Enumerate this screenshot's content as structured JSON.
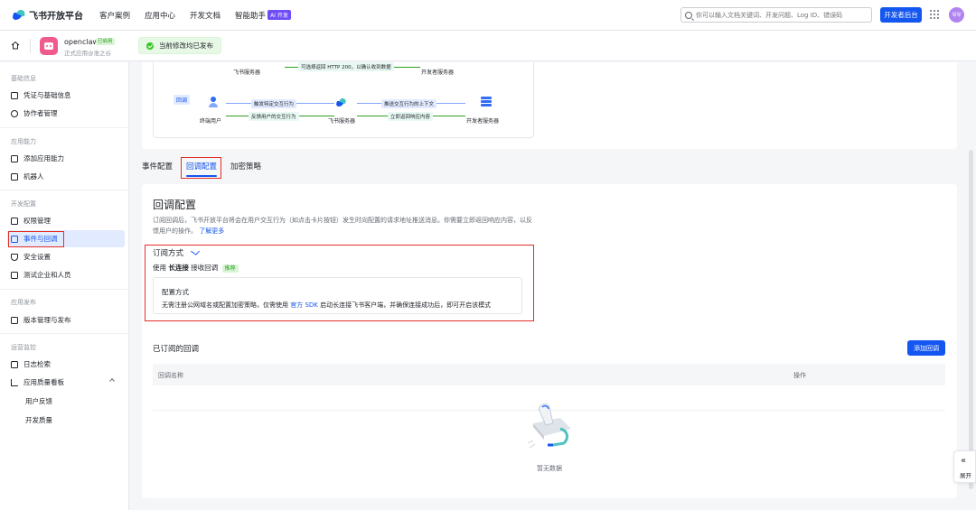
{
  "topbar": {
    "brand": "飞书开放平台",
    "nav": [
      "客户案例",
      "应用中心",
      "开发文档",
      "智能助手"
    ],
    "ai_badge": "AI 开发",
    "search_placeholder": "你可以输入文档关键词、开发问题、Log ID、错误码",
    "dev_button": "开发者后台",
    "avatar_text": "琴琴"
  },
  "appbar": {
    "app_name": "openclaw",
    "status_badge": "已启用",
    "app_subtitle": "正式应用@准之谷",
    "publish_notice": "当前修改均已发布"
  },
  "sidebar": {
    "groups": [
      {
        "title": "基础信息",
        "items": [
          "凭证与基础信息",
          "协作者管理"
        ]
      },
      {
        "title": "应用能力",
        "items": [
          "添加应用能力",
          "机器人"
        ]
      },
      {
        "title": "开发配置",
        "items": [
          "权限管理",
          "事件与回调",
          "安全设置",
          "测试企业和人员"
        ]
      },
      {
        "title": "应用发布",
        "items": [
          "版本管理与发布"
        ]
      },
      {
        "title": "运营监控",
        "items": [
          "日志检索",
          "应用质量看板"
        ]
      }
    ],
    "sub_items": [
      "用户反馈",
      "开发质量"
    ],
    "active_item": "事件与回调"
  },
  "diagram": {
    "top_pill": "可选择返回 HTTP 200，以确认收到数据",
    "top_left_label": "飞书服务器",
    "top_right_label": "开发者服务器",
    "callback_tag": "回调",
    "end_user": "终端用户",
    "feishu_server": "飞书服务器",
    "dev_server": "开发者服务器",
    "pill_trigger": "触发特定交互行为",
    "pill_feedback": "反馈用户的交互行为",
    "pill_push": "推送交互行为的上下文",
    "pill_return": "立即返回响应内容"
  },
  "tabs": [
    "事件配置",
    "回调配置",
    "加密策略"
  ],
  "active_tab": "回调配置",
  "callback": {
    "title": "回调配置",
    "desc": "订阅回调后，飞书开放平台将会在用户交互行为（如点击卡片按钮）发生时向配置的请求地址推送消息。你需要立即返回响应内容，以反馈用户的操作。",
    "learn_more": "了解更多",
    "sub_mode_label": "订阅方式",
    "use_prefix": "使用",
    "use_mode": "长连接",
    "use_suffix": "接收回调",
    "recommend_badge": "推荐",
    "config_title": "配置方式",
    "config_desc_prefix": "无需注册公网域名或配置加密策略，仅需使用",
    "config_sdk_link": "官方 SDK",
    "config_desc_suffix": "启动长连接飞书客户端，并确保连接成功后，即可开启该模式",
    "subscribed_title": "已订阅的回调",
    "add_button": "添加回调",
    "table_headers": [
      "回调名称",
      "操作"
    ],
    "empty_text": "暂无数据"
  },
  "expand_button": "展开"
}
